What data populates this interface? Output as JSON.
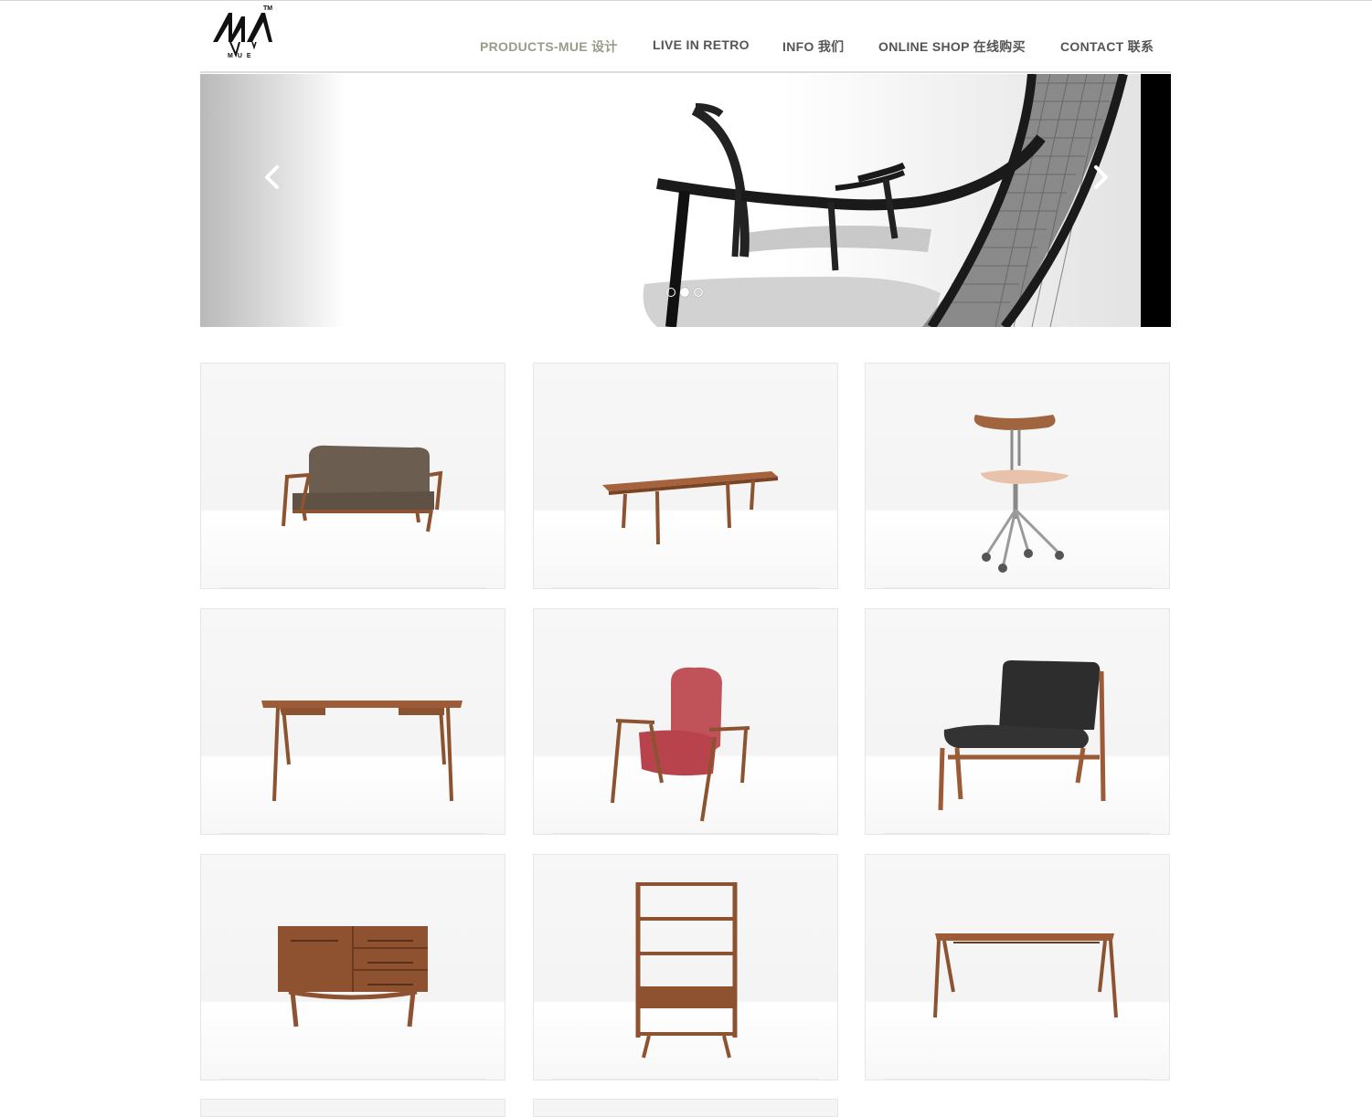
{
  "brand": {
    "logo_text": "MUE",
    "trademark": "TM",
    "logo_color": "#111111"
  },
  "nav": {
    "items": [
      {
        "label": "PRODUCTS-MUE 设计",
        "active": true
      },
      {
        "label": "LIVE IN RETRO",
        "active": false
      },
      {
        "label": "INFO 我们",
        "active": false
      },
      {
        "label": "ONLINE SHOP 在线购买",
        "active": false
      },
      {
        "label": "CONTACT 联系",
        "active": false
      }
    ],
    "active_color": "#9b9a8a",
    "color": "#555555"
  },
  "slider": {
    "image": "black-and-white-lounge-chair-photo",
    "prev_icon": "chevron-left-icon",
    "next_icon": "chevron-right-icon",
    "slide_count": 3,
    "active_slide": 2
  },
  "products": [
    {
      "name": "sofa"
    },
    {
      "name": "coffee-table"
    },
    {
      "name": "swivel-chair"
    },
    {
      "name": "writing-desk"
    },
    {
      "name": "red-wingback-lounge-chair"
    },
    {
      "name": "black-leather-lounge-chair"
    },
    {
      "name": "sideboard"
    },
    {
      "name": "bookshelf"
    },
    {
      "name": "console-table"
    }
  ],
  "colors": {
    "wood": "#9a5b36",
    "wood_dark": "#7a4424"
  }
}
